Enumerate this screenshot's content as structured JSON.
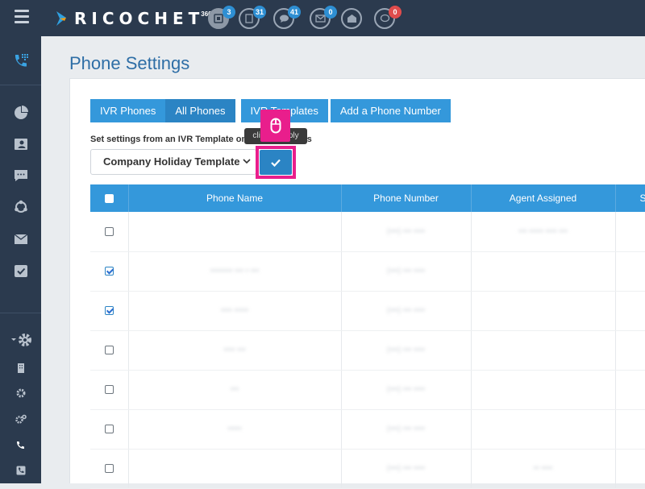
{
  "brand": {
    "name": "RICOCHET",
    "superscript": "360"
  },
  "header_icons": [
    {
      "name": "dashboard-icon",
      "badge": "3",
      "badge_color": "#2e8fd3",
      "active": true
    },
    {
      "name": "document-icon",
      "badge": "31",
      "badge_color": "#2e8fd3"
    },
    {
      "name": "chat-icon",
      "badge": "41",
      "badge_color": "#2e8fd3"
    },
    {
      "name": "mail-icon",
      "badge": "0",
      "badge_color": "#2e8fd3"
    },
    {
      "name": "mail-open-icon",
      "badge": ""
    },
    {
      "name": "comment-icon",
      "badge": "0",
      "badge_color": "#e04c4c"
    }
  ],
  "page": {
    "title": "Phone Settings"
  },
  "tabs": [
    {
      "label": "IVR Phones"
    },
    {
      "label": "All Phones",
      "active": true
    },
    {
      "label": "IVR Templates"
    },
    {
      "label": "Add a Phone Number"
    }
  ],
  "template_setting": {
    "label_start": "Set settings from an IVR Template on",
    "label_end": "hones",
    "selected_template": "Company Holiday Template",
    "tooltip": "click to apply"
  },
  "table": {
    "columns": [
      "Phone Name",
      "Phone Number",
      "Agent Assigned",
      "S"
    ],
    "rows": [
      {
        "checked": false,
        "phone_name": "",
        "phone_number": "(•••) ••• ••••",
        "agent": "••• ••••• •••• •••"
      },
      {
        "checked": true,
        "phone_name": "•••••••• ••• • •••",
        "phone_number": "(•••) ••• ••••",
        "agent": ""
      },
      {
        "checked": true,
        "phone_name": "•••• •••••",
        "phone_number": "(•••) ••• ••••",
        "agent": ""
      },
      {
        "checked": false,
        "phone_name": "•••• •••",
        "phone_number": "(•••) ••• ••••",
        "agent": ""
      },
      {
        "checked": false,
        "phone_name": "•••",
        "phone_number": "(•••) ••• ••••",
        "agent": ""
      },
      {
        "checked": false,
        "phone_name": "•••••",
        "phone_number": "(•••) ••• ••••",
        "agent": ""
      },
      {
        "checked": false,
        "phone_name": "",
        "phone_number": "(•••) ••• ••••",
        "agent": "•• ••••"
      }
    ]
  },
  "colors": {
    "accent": "#3498db",
    "highlight": "#e91e8c",
    "nav_bg": "#2b3a4e"
  }
}
